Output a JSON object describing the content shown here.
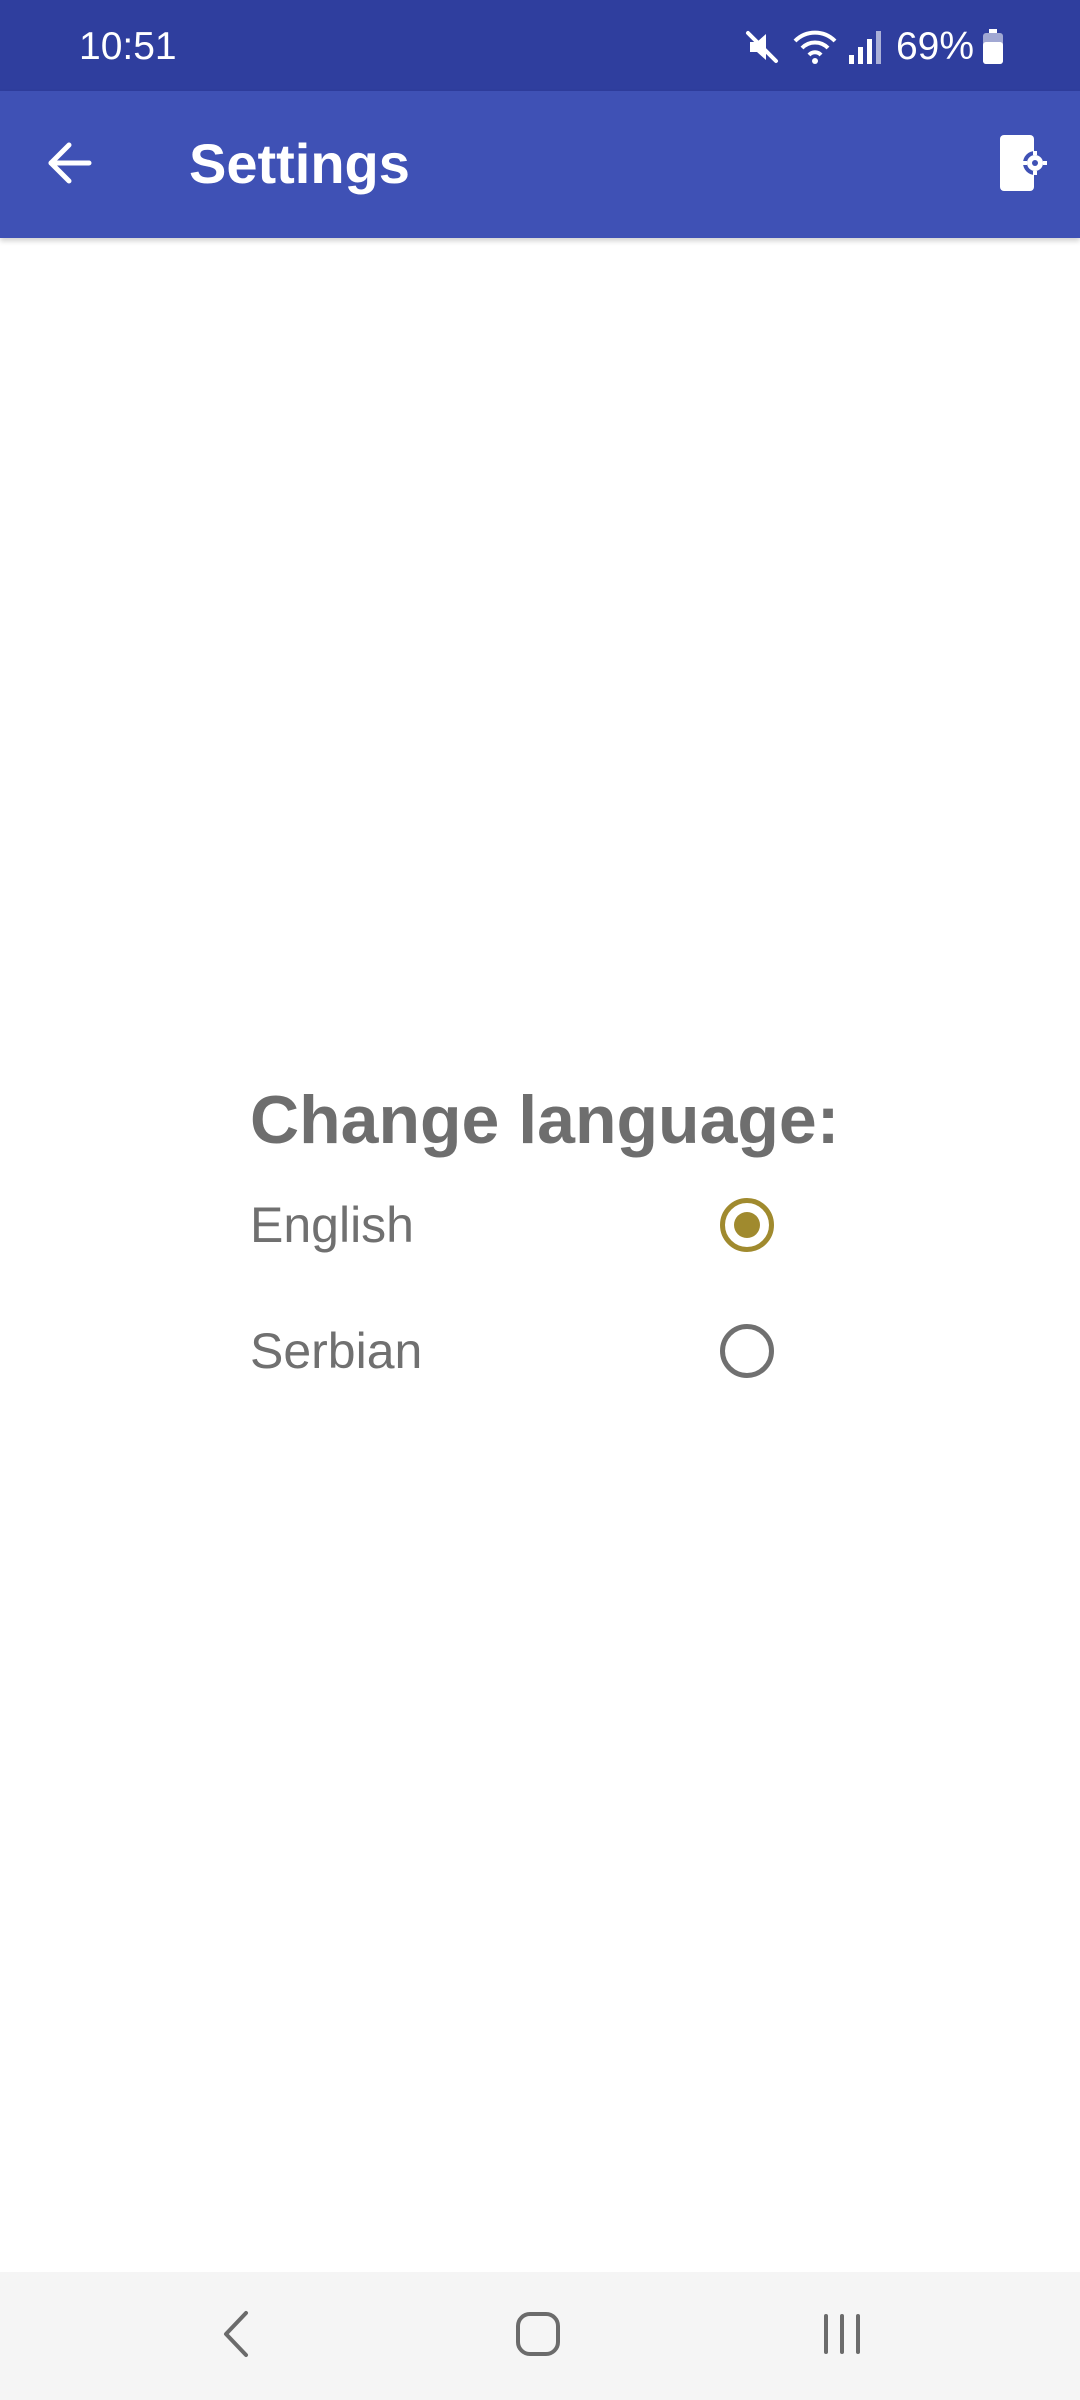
{
  "status_bar": {
    "time": "10:51",
    "battery_percent": "69%",
    "icons": [
      "mute-icon",
      "wifi-icon",
      "signal-icon",
      "battery-icon"
    ]
  },
  "app_bar": {
    "title": "Settings",
    "background_color": "#3f51b5",
    "back_icon": "arrow-back-icon",
    "action_icon": "device-settings-icon"
  },
  "language_section": {
    "title": "Change language:",
    "options": [
      {
        "label": "English",
        "selected": true
      },
      {
        "label": "Serbian",
        "selected": false
      }
    ],
    "accent_color": "#a08a2e"
  },
  "nav_bar": {
    "icons": [
      "nav-back-icon",
      "nav-home-icon",
      "nav-recents-icon"
    ]
  }
}
